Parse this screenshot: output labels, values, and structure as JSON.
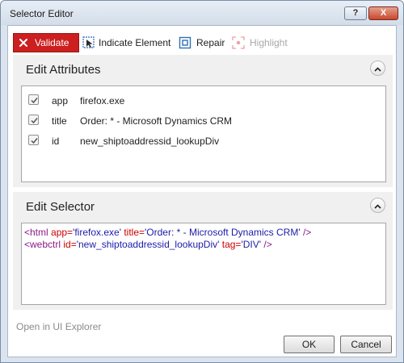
{
  "window": {
    "title": "Selector Editor",
    "help_label": "?",
    "close_label": "X"
  },
  "toolbar": {
    "validate_label": "Validate",
    "indicate_label": "Indicate Element",
    "repair_label": "Repair",
    "highlight_label": "Highlight"
  },
  "attributes": {
    "title": "Edit Attributes",
    "items": [
      {
        "checked": true,
        "name": "app",
        "value": "firefox.exe"
      },
      {
        "checked": true,
        "name": "title",
        "value": "Order: * - Microsoft Dynamics CRM"
      },
      {
        "checked": true,
        "name": "id",
        "value": "new_shiptoaddressid_lookupDiv"
      }
    ]
  },
  "selector": {
    "title": "Edit Selector",
    "line1": {
      "open": "<html ",
      "attr1": "app=",
      "val1": "'firefox.exe' ",
      "attr2": "title=",
      "val2": "'Order: * - Microsoft Dynamics CRM' ",
      "close": "/>"
    },
    "line2": {
      "open": "<webctrl ",
      "attr1": "id=",
      "val1": "'new_shiptoaddressid_lookupDiv' ",
      "attr2": "tag=",
      "val2": "'DIV' ",
      "close": "/>"
    }
  },
  "footer": {
    "open_explorer_label": "Open in UI Explorer",
    "ok_label": "OK",
    "cancel_label": "Cancel"
  },
  "colors": {
    "validate_bg": "#cc1f1f",
    "tag": "#8b1a8b",
    "attr_name": "#cc0000",
    "attr_value": "#1c1ca8"
  },
  "icons": {
    "validate": "x-icon",
    "indicate": "cursor-select-icon",
    "repair": "repair-target-icon",
    "highlight": "highlight-icon",
    "collapse": "chevron-up-icon"
  }
}
